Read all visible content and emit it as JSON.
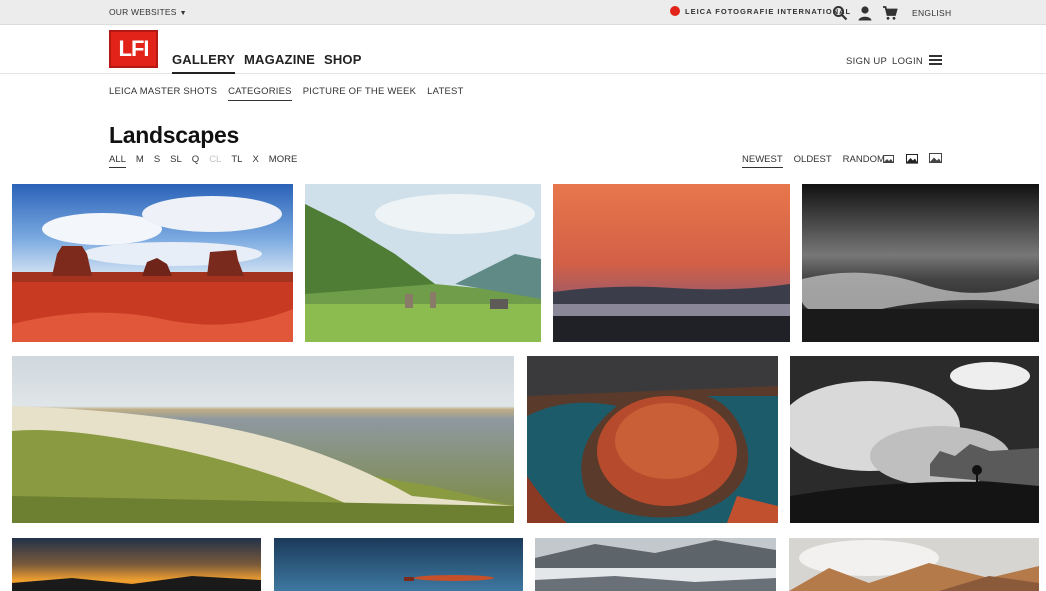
{
  "topbar": {
    "websites_label": "OUR WEBSITES",
    "brand_label": "LEICA FOTOGRAFIE INTERNATIONAL",
    "language": "ENGLISH",
    "icons": [
      "search-icon",
      "user-icon",
      "cart-icon"
    ]
  },
  "header": {
    "logo_text": "LFI",
    "nav": [
      "GALLERY",
      "MAGAZINE",
      "SHOP"
    ],
    "active_nav": "GALLERY",
    "signup": "SIGN UP",
    "login": "LOGIN"
  },
  "subnav": {
    "items": [
      "LEICA MASTER SHOTS",
      "CATEGORIES",
      "PICTURE OF THE WEEK",
      "LATEST"
    ],
    "active": "CATEGORIES"
  },
  "page": {
    "title": "Landscapes",
    "filters": [
      "ALL",
      "M",
      "S",
      "SL",
      "Q",
      "CL",
      "TL",
      "X",
      "MORE"
    ],
    "active_filter": "ALL",
    "disabled_filter": "CL",
    "sorts": [
      "NEWEST",
      "OLDEST",
      "RANDOM"
    ],
    "active_sort": "NEWEST",
    "view_icons": [
      "small-grid-view-icon",
      "medium-grid-view-icon",
      "large-grid-view-icon"
    ]
  },
  "colors": {
    "brand_red": "#e2231a",
    "topbar_bg": "#ececec"
  }
}
